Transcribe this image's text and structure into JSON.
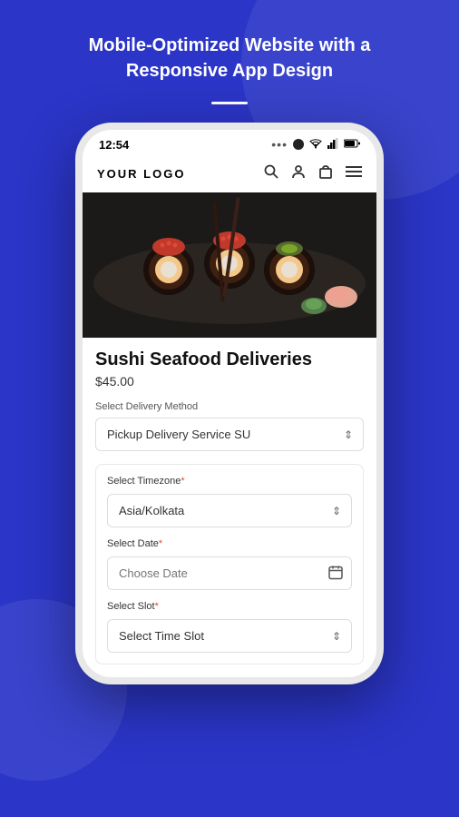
{
  "page": {
    "header_line1": "Mobile-Optimized Website with a",
    "header_line2": "Responsive App Design"
  },
  "phone": {
    "status_bar": {
      "time": "12:54",
      "dots": "...",
      "signal_icons": "▲ ◀ 🔋"
    },
    "nav": {
      "logo": "YOUR LOGO"
    },
    "product": {
      "title": "Sushi Seafood Deliveries",
      "price": "$45.00"
    },
    "form": {
      "delivery_method_label": "Select Delivery Method",
      "delivery_method_value": "Pickup Delivery Service SU",
      "timezone_label": "Select Timezone",
      "timezone_required": "*",
      "timezone_value": "Asia/Kolkata",
      "date_label": "Select Date",
      "date_required": "*",
      "date_placeholder": "Choose Date",
      "slot_label": "Select Slot",
      "slot_required": "*",
      "slot_placeholder": "Select Time Slot"
    }
  }
}
